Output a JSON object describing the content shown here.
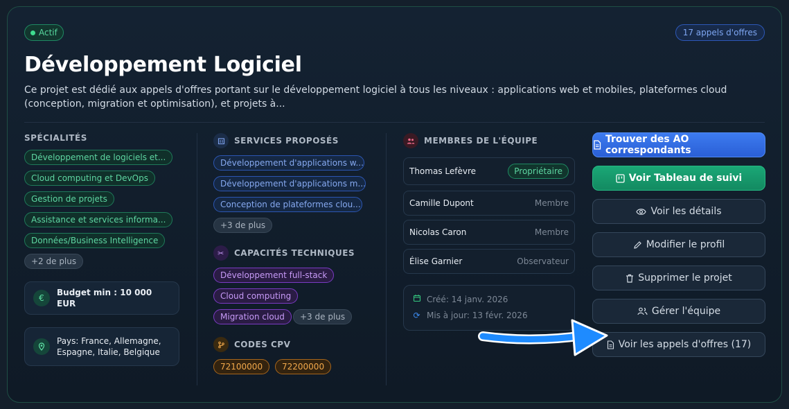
{
  "project": {
    "status": "Actif",
    "offers_count_label": "17 appels d'offres",
    "title": "Développement Logiciel",
    "description": "Ce projet est dédié aux appels d'offres portant sur le développement logiciel à tous les niveaux : applications web et mobiles, plateformes cloud (conception, migration et optimisation), et projets à..."
  },
  "specialties": {
    "title": "SPÉCIALITÉS",
    "tags": [
      "Développement de logiciels et...",
      "Cloud computing et DevOps",
      "Gestion de projets",
      "Assistance et services informa...",
      "Données/Business Intelligence"
    ],
    "more": "+2 de plus"
  },
  "budget": {
    "label": "Budget min : 10 000 EUR",
    "icon": "euro-icon"
  },
  "countries": {
    "label_line1": "Pays: France, Allemagne,",
    "label_line2": "Espagne, Italie, Belgique",
    "icon": "location-pin-icon"
  },
  "services": {
    "title": "SERVICES PROPOSÉS",
    "tags": [
      "Développement d'applications w...",
      "Développement d'applications m...",
      "Conception de plateformes clou..."
    ],
    "more": "+3 de plus"
  },
  "capabilities": {
    "title": "CAPACITÉS TECHNIQUES",
    "tags": [
      "Développement full-stack",
      "Cloud computing",
      "Migration cloud"
    ],
    "more": "+3 de plus"
  },
  "cpv": {
    "title": "CODES CPV",
    "codes": [
      "72100000",
      "72200000"
    ]
  },
  "team": {
    "title": "MEMBRES DE L'ÉQUIPE",
    "members": [
      {
        "name": "Thomas Lefèvre",
        "role": "Propriétaire"
      },
      {
        "name": "Camille Dupont",
        "role": "Membre"
      },
      {
        "name": "Nicolas Caron",
        "role": "Membre"
      },
      {
        "name": "Élise Garnier",
        "role": "Observateur"
      }
    ],
    "created": "Créé: 14 janv. 2026",
    "updated": "Mis à jour: 13 févr. 2026"
  },
  "actions": {
    "find": "Trouver des AO correspondants",
    "board": "Voir Tableau de suivi",
    "details": "Voir les détails",
    "edit": "Modifier le profil",
    "delete": "Supprimer le projet",
    "team": "Gérer l'équipe",
    "offers": "Voir les appels d'offres (17)"
  },
  "colors": {
    "accent_blue": "#3d7bef",
    "accent_green": "#1aa776",
    "arrow": "#1e8bff"
  }
}
